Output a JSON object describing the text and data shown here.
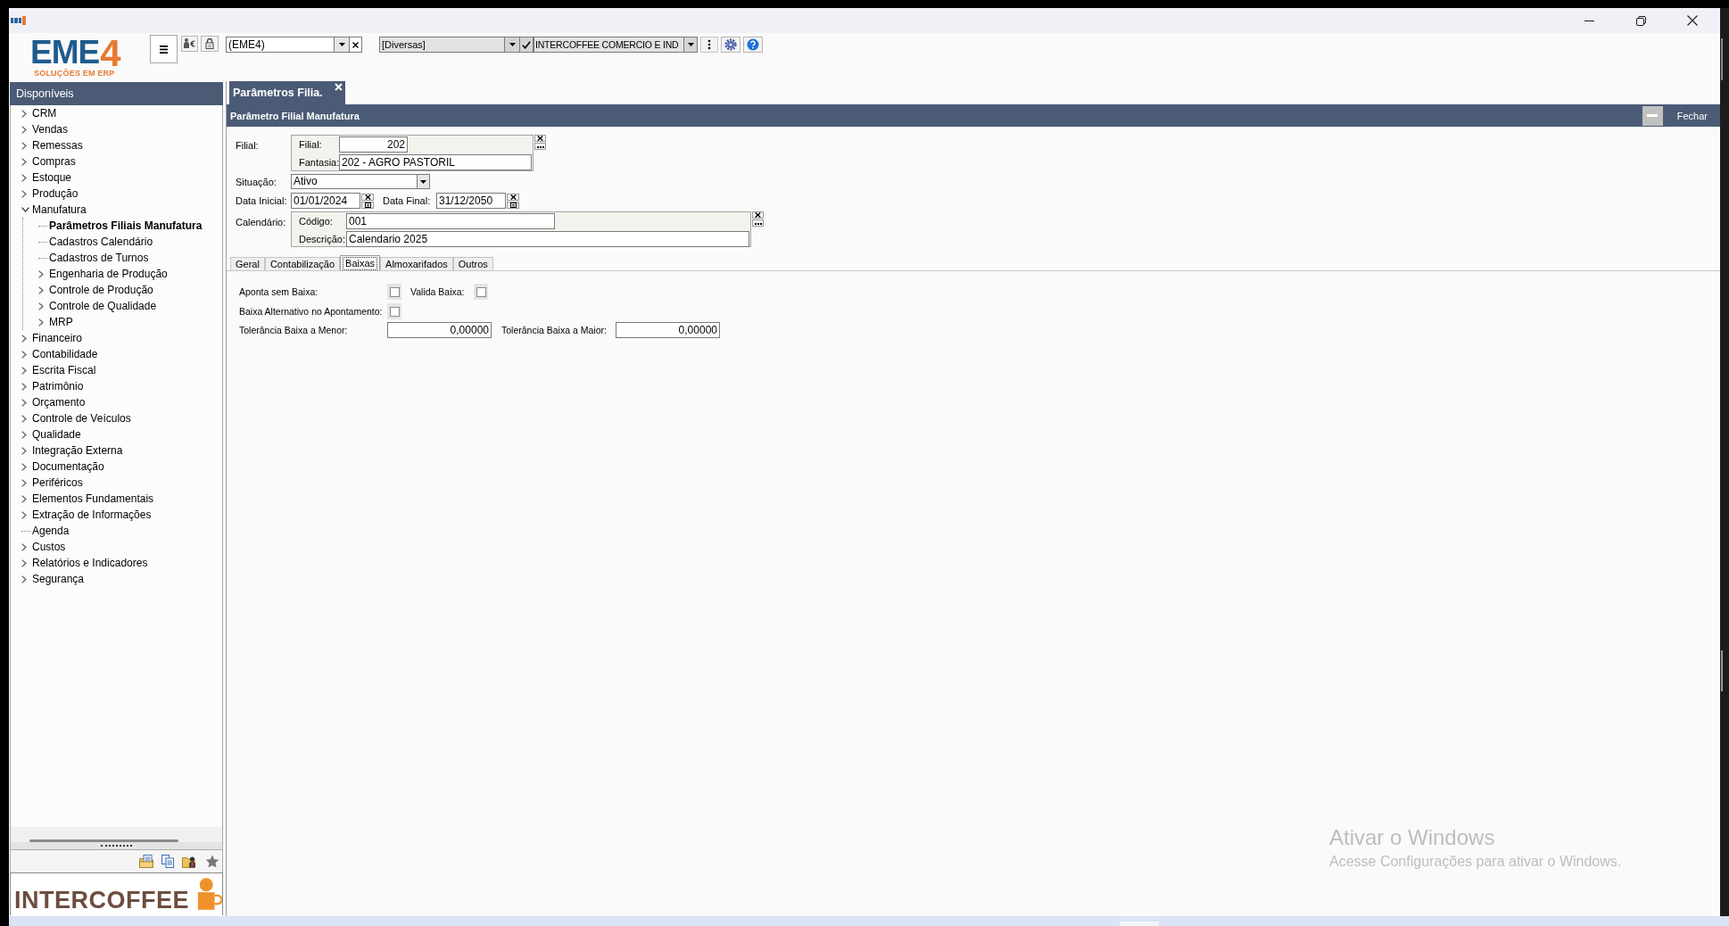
{
  "toolbar": {
    "logo": {
      "letters": "EME",
      "digit": "4",
      "tagline": "SOLUÇÕES EM ERP"
    },
    "database": {
      "value": "(EME4)"
    },
    "category": {
      "value": "[Diversas]"
    },
    "company": {
      "value": "INTERCOFFEE COMERCIO E IND"
    }
  },
  "sidebar": {
    "title": "Disponíveis",
    "items": [
      {
        "label": "CRM",
        "kind": "folder",
        "expanded": false,
        "selected": false
      },
      {
        "label": "Vendas",
        "kind": "folder",
        "expanded": false,
        "selected": false
      },
      {
        "label": "Remessas",
        "kind": "folder",
        "expanded": false,
        "selected": false
      },
      {
        "label": "Compras",
        "kind": "folder",
        "expanded": false,
        "selected": false
      },
      {
        "label": "Estoque",
        "kind": "folder",
        "expanded": false,
        "selected": false
      },
      {
        "label": "Produção",
        "kind": "folder",
        "expanded": false,
        "selected": false
      },
      {
        "label": "Manufatura",
        "kind": "folder",
        "expanded": true,
        "selected": false,
        "children": [
          {
            "label": "Parâmetros Filiais Manufatura",
            "kind": "leaf",
            "selected": true
          },
          {
            "label": "Cadastros Calendário",
            "kind": "leaf",
            "selected": false
          },
          {
            "label": "Cadastros de Turnos",
            "kind": "leaf",
            "selected": false
          },
          {
            "label": "Engenharia de Produção",
            "kind": "folder",
            "expanded": false,
            "selected": false
          },
          {
            "label": "Controle de Produção",
            "kind": "folder",
            "expanded": false,
            "selected": false
          },
          {
            "label": "Controle de Qualidade",
            "kind": "folder",
            "expanded": false,
            "selected": false
          },
          {
            "label": "MRP",
            "kind": "folder",
            "expanded": false,
            "selected": false
          }
        ]
      },
      {
        "label": "Financeiro",
        "kind": "folder",
        "expanded": false,
        "selected": false
      },
      {
        "label": "Contabilidade",
        "kind": "folder",
        "expanded": false,
        "selected": false
      },
      {
        "label": "Escrita Fiscal",
        "kind": "folder",
        "expanded": false,
        "selected": false
      },
      {
        "label": "Patrimônio",
        "kind": "folder",
        "expanded": false,
        "selected": false
      },
      {
        "label": "Orçamento",
        "kind": "folder",
        "expanded": false,
        "selected": false
      },
      {
        "label": "Controle de Veículos",
        "kind": "folder",
        "expanded": false,
        "selected": false
      },
      {
        "label": "Qualidade",
        "kind": "folder",
        "expanded": false,
        "selected": false
      },
      {
        "label": "Integração Externa",
        "kind": "folder",
        "expanded": false,
        "selected": false
      },
      {
        "label": "Documentação",
        "kind": "folder",
        "expanded": false,
        "selected": false
      },
      {
        "label": "Periféricos",
        "kind": "folder",
        "expanded": false,
        "selected": false
      },
      {
        "label": "Elementos Fundamentais",
        "kind": "folder",
        "expanded": false,
        "selected": false
      },
      {
        "label": "Extração de Informações",
        "kind": "folder",
        "expanded": false,
        "selected": false
      },
      {
        "label": "Agenda",
        "kind": "leaf",
        "selected": false
      },
      {
        "label": "Custos",
        "kind": "folder",
        "expanded": false,
        "selected": false
      },
      {
        "label": "Relatórios e Indicadores",
        "kind": "folder",
        "expanded": false,
        "selected": false
      },
      {
        "label": "Segurança",
        "kind": "folder",
        "expanded": false,
        "selected": false
      }
    ],
    "brand": "INTERCOFFEE"
  },
  "tabs": [
    {
      "label": "Parâmetros Filia.",
      "selected": true
    }
  ],
  "panel": {
    "title": "Parâmetro Filial Manufatura",
    "close_label": "Fechar"
  },
  "form": {
    "filial": {
      "label": "Filial:",
      "code_label": "Filial:",
      "code": "202",
      "name_label": "Fantasia:",
      "name": "202 - AGRO PASTORIL"
    },
    "situacao": {
      "label": "Situação:",
      "value": "Ativo"
    },
    "dates": [
      {
        "label": "Data Inicial:",
        "value": "01/01/2024"
      },
      {
        "label": "Data Final:",
        "value": "31/12/2050"
      }
    ],
    "calendario": {
      "label": "Calendário:",
      "code_label": "Código:",
      "code": "001",
      "name_label": "Descrição:",
      "name": "Calendario 2025"
    }
  },
  "subtabs": [
    {
      "label": "Geral",
      "selected": false
    },
    {
      "label": "Contabilização",
      "selected": false
    },
    {
      "label": "Baixas",
      "selected": true
    },
    {
      "label": "Almoxarifados",
      "selected": false
    },
    {
      "label": "Outros",
      "selected": false
    }
  ],
  "baixas": {
    "checks": [
      {
        "label": "Aponta sem Baixa:",
        "checked": false
      },
      {
        "label": "Valida Baixa:",
        "checked": false
      },
      {
        "label": "Baixa Alternativo no Apontamento:",
        "checked": false
      }
    ],
    "tolerances": [
      {
        "label": "Tolerância Baixa a Menor:",
        "value": "0,00000"
      },
      {
        "label": "Tolerância Baixa a Maior:",
        "value": "0,00000"
      }
    ]
  },
  "activation_notice": {
    "title": "Ativar o Windows",
    "message": "Acesse Configurações para ativar o Windows."
  }
}
